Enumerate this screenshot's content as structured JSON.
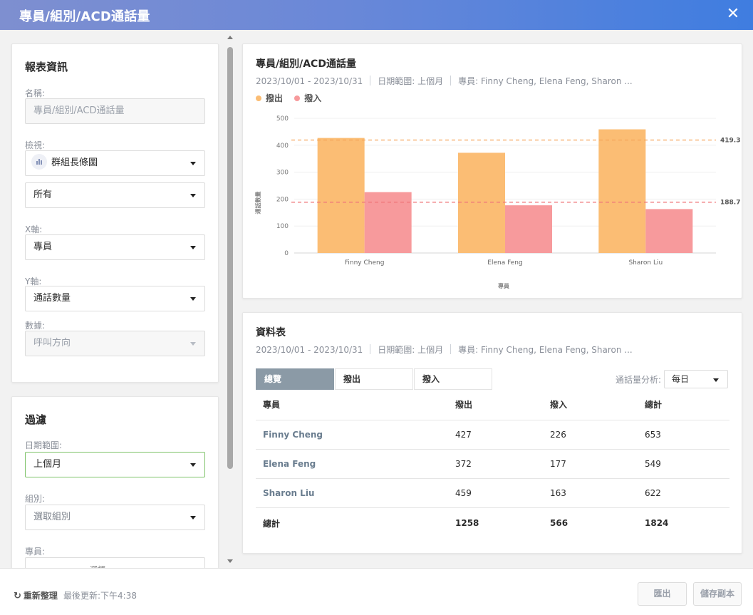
{
  "window": {
    "title": "專員/組別/ACD通話量",
    "close_glyph": "✕"
  },
  "report_info": {
    "section_title": "報表資訊",
    "name_label": "名稱:",
    "name_placeholder": "專員/組別/ACD通話量",
    "view_label": "檢視:",
    "view_value": "群組長條圖",
    "view_icon": "bar-chart-icon",
    "scope_value": "所有",
    "x_axis_label": "X軸:",
    "x_axis_value": "專員",
    "y_axis_label": "Y軸:",
    "y_axis_value": "通話數量",
    "data_label": "數據:",
    "data_value": "呼叫方向"
  },
  "filters": {
    "section_title": "過濾",
    "date_range_label": "日期範圍:",
    "date_range_value": "上個月",
    "group_label": "組別:",
    "group_placeholder": "選取組別",
    "agent_label": "專員:",
    "agent_value_partial": "選擇"
  },
  "chart_card": {
    "title": "專員/組別/ACD通話量",
    "date_span": "2023/10/01 - 2023/10/31",
    "range_text": "日期範圍: 上個月",
    "agents_text": "專員: Finny Cheng, Elena Feng, Sharon ..."
  },
  "chart_data": {
    "type": "bar",
    "categories": [
      "Finny Cheng",
      "Elena Feng",
      "Sharon Liu"
    ],
    "series": [
      {
        "name": "撥出",
        "values": [
          427,
          372,
          459
        ],
        "color": "#fbbd74"
      },
      {
        "name": "撥入",
        "values": [
          226,
          177,
          163
        ],
        "color": "#f79a9c"
      }
    ],
    "xlabel": "專員",
    "ylabel": "通話數量",
    "ylim": [
      0,
      500
    ],
    "yticks": [
      0,
      100,
      200,
      300,
      400,
      500
    ],
    "reference_lines": [
      {
        "value": 419.3,
        "label": "419.3",
        "color": "#f5a45a"
      },
      {
        "value": 188.7,
        "label": "188.7",
        "color": "#f0767a"
      }
    ],
    "legend_position": "top-left",
    "grid": true
  },
  "table_card": {
    "title": "資料表",
    "date_span": "2023/10/01 - 2023/10/31",
    "range_text": "日期範圍: 上個月",
    "agents_text": "專員: Finny Cheng, Elena Feng, Sharon ...",
    "tabs": [
      "總覽",
      "撥出",
      "撥入"
    ],
    "analysis_label": "通話量分析:",
    "analysis_value": "每日",
    "columns": [
      "專員",
      "撥出",
      "撥入",
      "總計"
    ],
    "rows": [
      [
        "Finny Cheng",
        "427",
        "226",
        "653"
      ],
      [
        "Elena Feng",
        "372",
        "177",
        "549"
      ],
      [
        "Sharon Liu",
        "459",
        "163",
        "622"
      ]
    ],
    "total_row": [
      "總計",
      "1258",
      "566",
      "1824"
    ]
  },
  "footer": {
    "refresh_label": "重新整理",
    "refresh_glyph": "↻",
    "last_updated": "最後更新:下午4:38",
    "export_label": "匯出",
    "save_copy_label": "儲存副本"
  }
}
